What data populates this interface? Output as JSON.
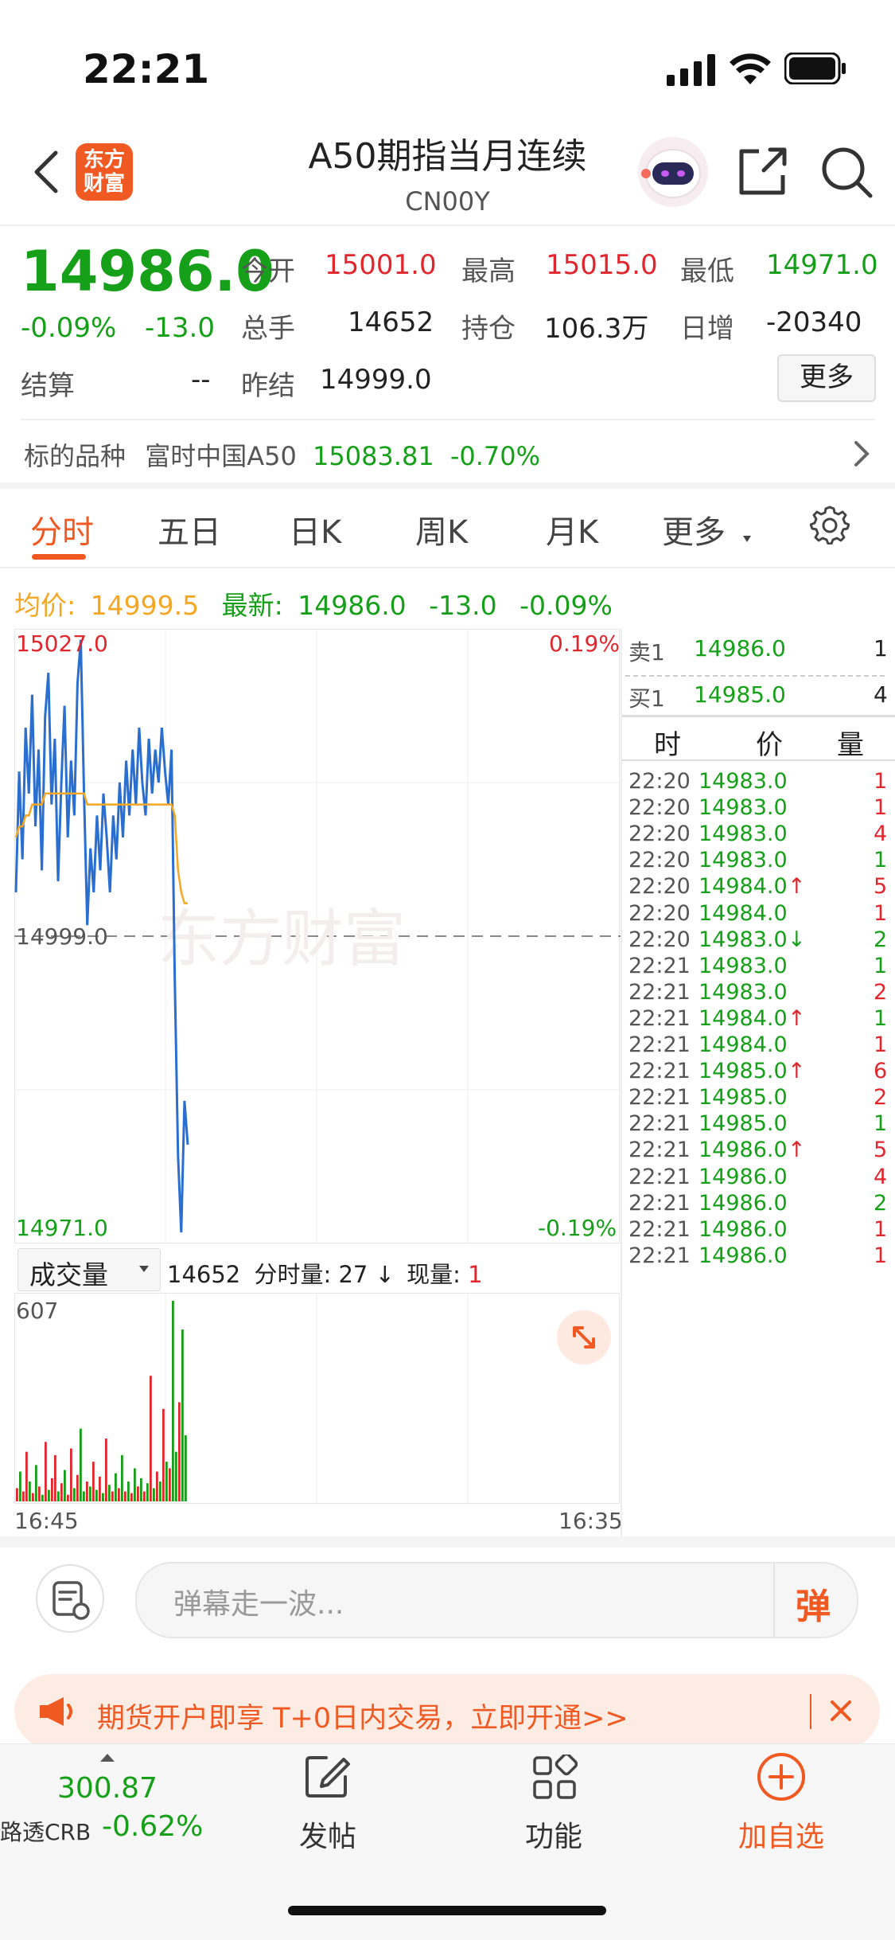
{
  "status_bar": {
    "time": "22:21"
  },
  "header": {
    "title": "A50期指当月连续",
    "subtitle": "CN00Y",
    "logo_text": "东方财富"
  },
  "quote": {
    "price": "14986.0",
    "pct": "-0.09%",
    "change": "-13.0",
    "rows": [
      {
        "l1": "今开",
        "v1": "15001.0",
        "l2": "最高",
        "v2": "15015.0",
        "l3": "最低",
        "v3": "14971.0"
      },
      {
        "l1": "总手",
        "v1": "14652",
        "l2": "持仓",
        "v2": "106.3万",
        "l3": "日增",
        "v3": "-20340"
      }
    ],
    "settle_label": "结算",
    "settle_value": "--",
    "prev_settle_label": "昨结",
    "prev_settle_value": "14999.0",
    "more_label": "更多"
  },
  "underlying": {
    "label": "标的品种",
    "name": "富时中国A50",
    "price": "15083.81",
    "pct": "-0.70%"
  },
  "tabs": [
    "分时",
    "五日",
    "日K",
    "周K",
    "月K",
    "更多"
  ],
  "active_tab": "分时",
  "chart_header": {
    "avg_label": "均价:",
    "avg_value": "14999.5",
    "latest_label": "最新:",
    "latest_value": "14986.0",
    "latest_change": "-13.0",
    "latest_pct": "-0.09%"
  },
  "chart_data": {
    "type": "line",
    "ylim": [
      14971.0,
      15027.0
    ],
    "y_top_label": "15027.0",
    "y_mid_label": "14999.0",
    "y_bottom_label": "14971.0",
    "pct_top_label": "0.19%",
    "pct_bottom_label": "-0.19%",
    "x_left_label": "16:45",
    "x_right_label": "16:35",
    "watermark": "东方财富",
    "series": [
      {
        "values": [
          15003,
          15014,
          15006,
          15018,
          15012,
          15021,
          15009,
          15016,
          15005,
          15019,
          15023,
          15011,
          15017,
          15004,
          15013,
          15020,
          15008,
          15015,
          15010,
          15022,
          15026,
          15012,
          15000,
          15007,
          15003,
          15010,
          15005,
          15012,
          15008,
          15003,
          15010,
          15006,
          15013,
          15008,
          15015,
          15010,
          15016,
          15011,
          15018,
          15013,
          15010,
          15017,
          15012,
          15016,
          15013,
          15018,
          15014,
          15011,
          15016,
          14995,
          14979,
          14972,
          14984,
          14980
        ]
      },
      {
        "values": [
          15008,
          15009,
          15009,
          15010,
          15010,
          15011,
          15011,
          15011,
          15011,
          15012,
          15012,
          15012,
          15012,
          15012,
          15012,
          15012,
          15012,
          15012,
          15012,
          15012,
          15012,
          15012,
          15011,
          15011,
          15011,
          15011,
          15011,
          15011,
          15011,
          15011,
          15011,
          15011,
          15011,
          15011,
          15011,
          15011,
          15011,
          15011,
          15011,
          15011,
          15011,
          15011,
          15011,
          15011,
          15011,
          15011,
          15011,
          15011,
          15011,
          15010,
          15005,
          15003,
          15002,
          15002
        ]
      }
    ],
    "volume": {
      "max_label": "607",
      "ylim": [
        0,
        607
      ],
      "values": [
        40,
        90,
        30,
        150,
        60,
        25,
        110,
        45,
        20,
        180,
        35,
        70,
        140,
        30,
        55,
        95,
        20,
        160,
        40,
        80,
        220,
        30,
        60,
        45,
        120,
        35,
        75,
        25,
        190,
        50,
        30,
        85,
        40,
        140,
        30,
        60,
        25,
        100,
        45,
        70,
        30,
        55,
        380,
        40,
        90,
        60,
        280,
        120,
        100,
        607,
        150,
        300,
        520,
        200
      ],
      "colors": [
        "r",
        "g",
        "r",
        "r",
        "g",
        "r",
        "g",
        "r",
        "g",
        "r",
        "g",
        "r",
        "r",
        "g",
        "r",
        "g",
        "r",
        "r",
        "g",
        "r",
        "g",
        "g",
        "r",
        "g",
        "r",
        "g",
        "r",
        "g",
        "r",
        "g",
        "r",
        "g",
        "r",
        "g",
        "r",
        "g",
        "r",
        "g",
        "r",
        "g",
        "r",
        "g",
        "r",
        "g",
        "r",
        "g",
        "r",
        "g",
        "r",
        "g",
        "g",
        "r",
        "g",
        "g"
      ]
    }
  },
  "volume_bar": {
    "selector": "成交量",
    "total": "14652",
    "fenshi_label": "分时量:",
    "fenshi_value": "27",
    "arrow": "↓",
    "now_label": "现量:",
    "now_value": "1"
  },
  "order_book": {
    "ask": {
      "label": "卖1",
      "price": "14986.0",
      "qty": "1"
    },
    "bid": {
      "label": "买1",
      "price": "14985.0",
      "qty": "4"
    },
    "headers": [
      "时",
      "价",
      "量"
    ],
    "trades": [
      {
        "t": "22:20",
        "p": "14983.0",
        "a": "",
        "q": "1",
        "c": "r"
      },
      {
        "t": "22:20",
        "p": "14983.0",
        "a": "",
        "q": "1",
        "c": "r"
      },
      {
        "t": "22:20",
        "p": "14983.0",
        "a": "",
        "q": "4",
        "c": "r"
      },
      {
        "t": "22:20",
        "p": "14983.0",
        "a": "",
        "q": "1",
        "c": "g"
      },
      {
        "t": "22:20",
        "p": "14984.0",
        "a": "↑",
        "q": "5",
        "c": "r"
      },
      {
        "t": "22:20",
        "p": "14984.0",
        "a": "",
        "q": "1",
        "c": "r"
      },
      {
        "t": "22:20",
        "p": "14983.0",
        "a": "↓",
        "q": "2",
        "c": "g"
      },
      {
        "t": "22:21",
        "p": "14983.0",
        "a": "",
        "q": "1",
        "c": "g"
      },
      {
        "t": "22:21",
        "p": "14983.0",
        "a": "",
        "q": "2",
        "c": "r"
      },
      {
        "t": "22:21",
        "p": "14984.0",
        "a": "↑",
        "q": "1",
        "c": "g"
      },
      {
        "t": "22:21",
        "p": "14984.0",
        "a": "",
        "q": "1",
        "c": "r"
      },
      {
        "t": "22:21",
        "p": "14985.0",
        "a": "↑",
        "q": "6",
        "c": "r"
      },
      {
        "t": "22:21",
        "p": "14985.0",
        "a": "",
        "q": "2",
        "c": "r"
      },
      {
        "t": "22:21",
        "p": "14985.0",
        "a": "",
        "q": "1",
        "c": "g"
      },
      {
        "t": "22:21",
        "p": "14986.0",
        "a": "↑",
        "q": "5",
        "c": "r"
      },
      {
        "t": "22:21",
        "p": "14986.0",
        "a": "",
        "q": "4",
        "c": "r"
      },
      {
        "t": "22:21",
        "p": "14986.0",
        "a": "",
        "q": "2",
        "c": "g"
      },
      {
        "t": "22:21",
        "p": "14986.0",
        "a": "",
        "q": "1",
        "c": "r"
      },
      {
        "t": "22:21",
        "p": "14986.0",
        "a": "",
        "q": "1",
        "c": "r"
      }
    ]
  },
  "comment": {
    "placeholder": "弹幕走一波...",
    "send_label": "弹"
  },
  "banner": {
    "text": "期货开户即享 T+0日内交易，立即开通>>"
  },
  "bottom_nav": {
    "ticker_price": "300.87",
    "ticker_name": "路透CRB",
    "ticker_pct": "-0.62%",
    "items": [
      "发帖",
      "功能",
      "加自选"
    ]
  },
  "colors": {
    "up": "#e0272e",
    "down": "#16a019",
    "accent": "#f05a22",
    "avg": "#f5a623",
    "price_line": "#2a6fd0"
  }
}
